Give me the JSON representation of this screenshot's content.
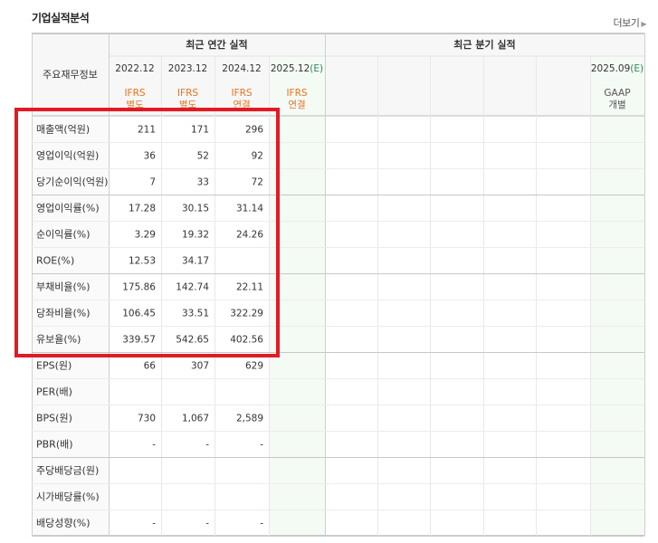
{
  "title": "기업실적분석",
  "more_label": "더보기",
  "header": {
    "row_label": "주요재무정보",
    "annual_group": "최근 연간 실적",
    "quarter_group": "최근 분기 실적",
    "annual_columns": [
      {
        "date": "2022.12",
        "estimate": "",
        "acc_line1": "IFRS",
        "acc_line2": "별도"
      },
      {
        "date": "2023.12",
        "estimate": "",
        "acc_line1": "IFRS",
        "acc_line2": "별도"
      },
      {
        "date": "2024.12",
        "estimate": "",
        "acc_line1": "IFRS",
        "acc_line2": "연결"
      },
      {
        "date": "2025.12",
        "estimate": "(E)",
        "acc_line1": "IFRS",
        "acc_line2": "연결"
      }
    ],
    "quarter_last": {
      "date": "2025.09",
      "estimate": "(E)",
      "acc_line1": "GAAP",
      "acc_line2": "개별"
    }
  },
  "rows": [
    {
      "label": "매출액(억원)",
      "values": [
        "211",
        "171",
        "296"
      ]
    },
    {
      "label": "영업이익(억원)",
      "values": [
        "36",
        "52",
        "92"
      ]
    },
    {
      "label": "당기순이익(억원)",
      "values": [
        "7",
        "33",
        "72"
      ]
    },
    {
      "label": "영업이익률(%)",
      "values": [
        "17.28",
        "30.15",
        "31.14"
      ]
    },
    {
      "label": "순이익률(%)",
      "values": [
        "3.29",
        "19.32",
        "24.26"
      ]
    },
    {
      "label": "ROE(%)",
      "values": [
        "12.53",
        "34.17",
        ""
      ]
    },
    {
      "label": "부채비율(%)",
      "values": [
        "175.86",
        "142.74",
        "22.11"
      ]
    },
    {
      "label": "당좌비율(%)",
      "values": [
        "106.45",
        "33.51",
        "322.29"
      ]
    },
    {
      "label": "유보율(%)",
      "values": [
        "339.57",
        "542.65",
        "402.56"
      ]
    },
    {
      "label": "EPS(원)",
      "values": [
        "66",
        "307",
        "629"
      ]
    },
    {
      "label": "PER(배)",
      "values": [
        "",
        "",
        ""
      ]
    },
    {
      "label": "BPS(원)",
      "values": [
        "730",
        "1,067",
        "2,589"
      ]
    },
    {
      "label": "PBR(배)",
      "values": [
        "-",
        "-",
        "-"
      ]
    },
    {
      "label": "주당배당금(원)",
      "values": [
        "",
        "",
        ""
      ]
    },
    {
      "label": "시가배당률(%)",
      "values": [
        "",
        "",
        ""
      ]
    },
    {
      "label": "배당성향(%)",
      "values": [
        "-",
        "-",
        "-"
      ]
    }
  ],
  "colors": {
    "accounting_ifrs": "#e8731f",
    "estimate": "#2e8b57",
    "estimate_column_bg": "#f4faf4",
    "header_bg": "#f7f7f7",
    "highlight_box": "#e11b24"
  }
}
